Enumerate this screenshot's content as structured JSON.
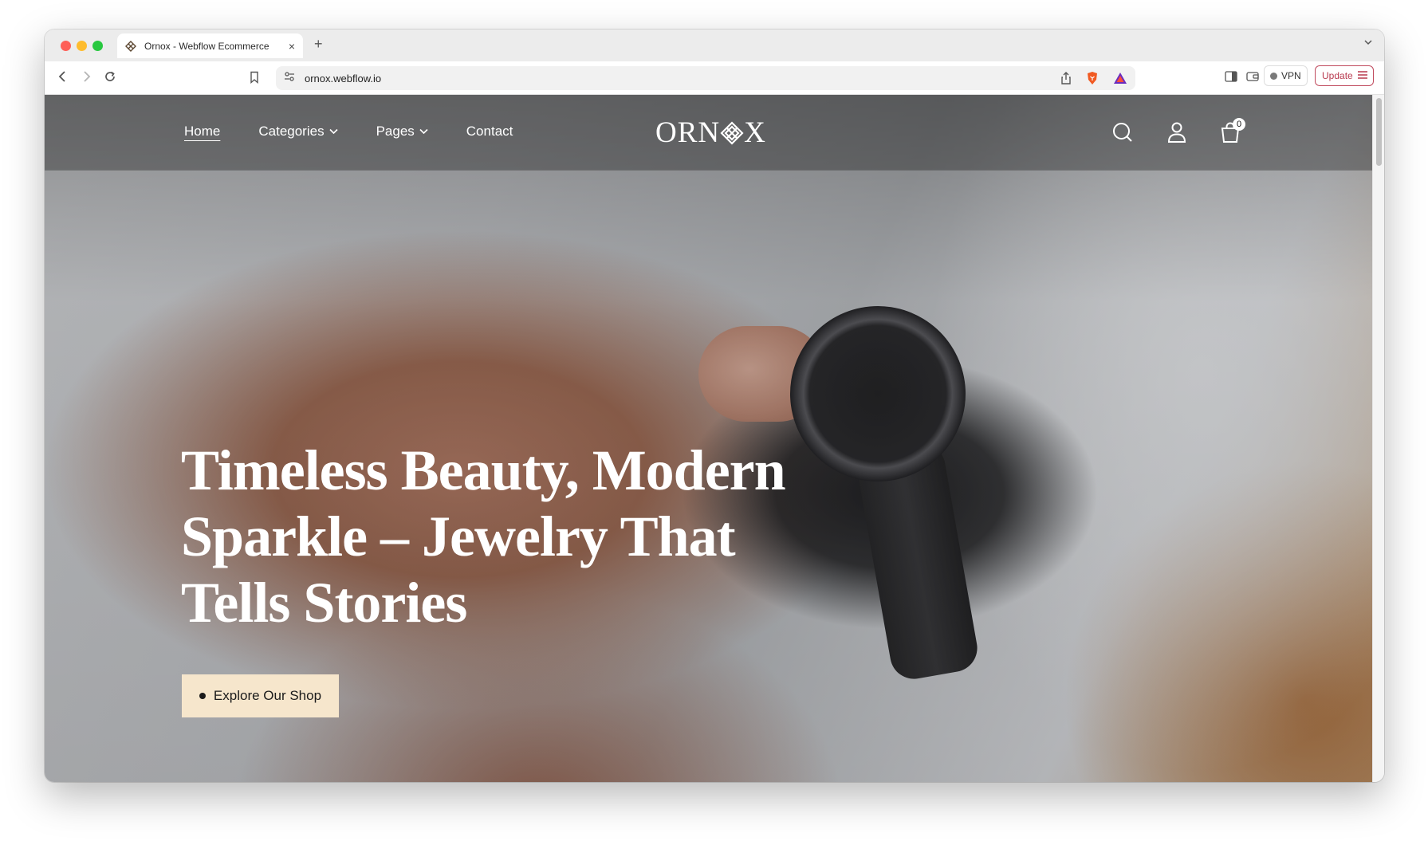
{
  "browser": {
    "tab_title": "Ornox - Webflow Ecommerce",
    "tab_close": "×",
    "new_tab": "+",
    "url": "ornox.webflow.io",
    "vpn_label": "VPN",
    "update_label": "Update"
  },
  "site": {
    "nav": [
      {
        "label": "Home",
        "has_dropdown": false,
        "active": true
      },
      {
        "label": "Categories",
        "has_dropdown": true,
        "active": false
      },
      {
        "label": "Pages",
        "has_dropdown": true,
        "active": false
      },
      {
        "label": "Contact",
        "has_dropdown": false,
        "active": false
      }
    ],
    "logo_left": "ORN",
    "logo_right": "X",
    "cart_count": "0",
    "hero_title": "Timeless Beauty, Modern Sparkle – Jewelry That Tells Stories",
    "cta_label": "Explore Our Shop"
  },
  "colors": {
    "cta_bg": "#f6e6cc",
    "update_accent": "#b83a4f"
  },
  "icons": [
    "search-icon",
    "user-icon",
    "cart-icon",
    "chevron-down-icon",
    "brave-lion-icon",
    "share-icon",
    "bookmark-icon"
  ]
}
